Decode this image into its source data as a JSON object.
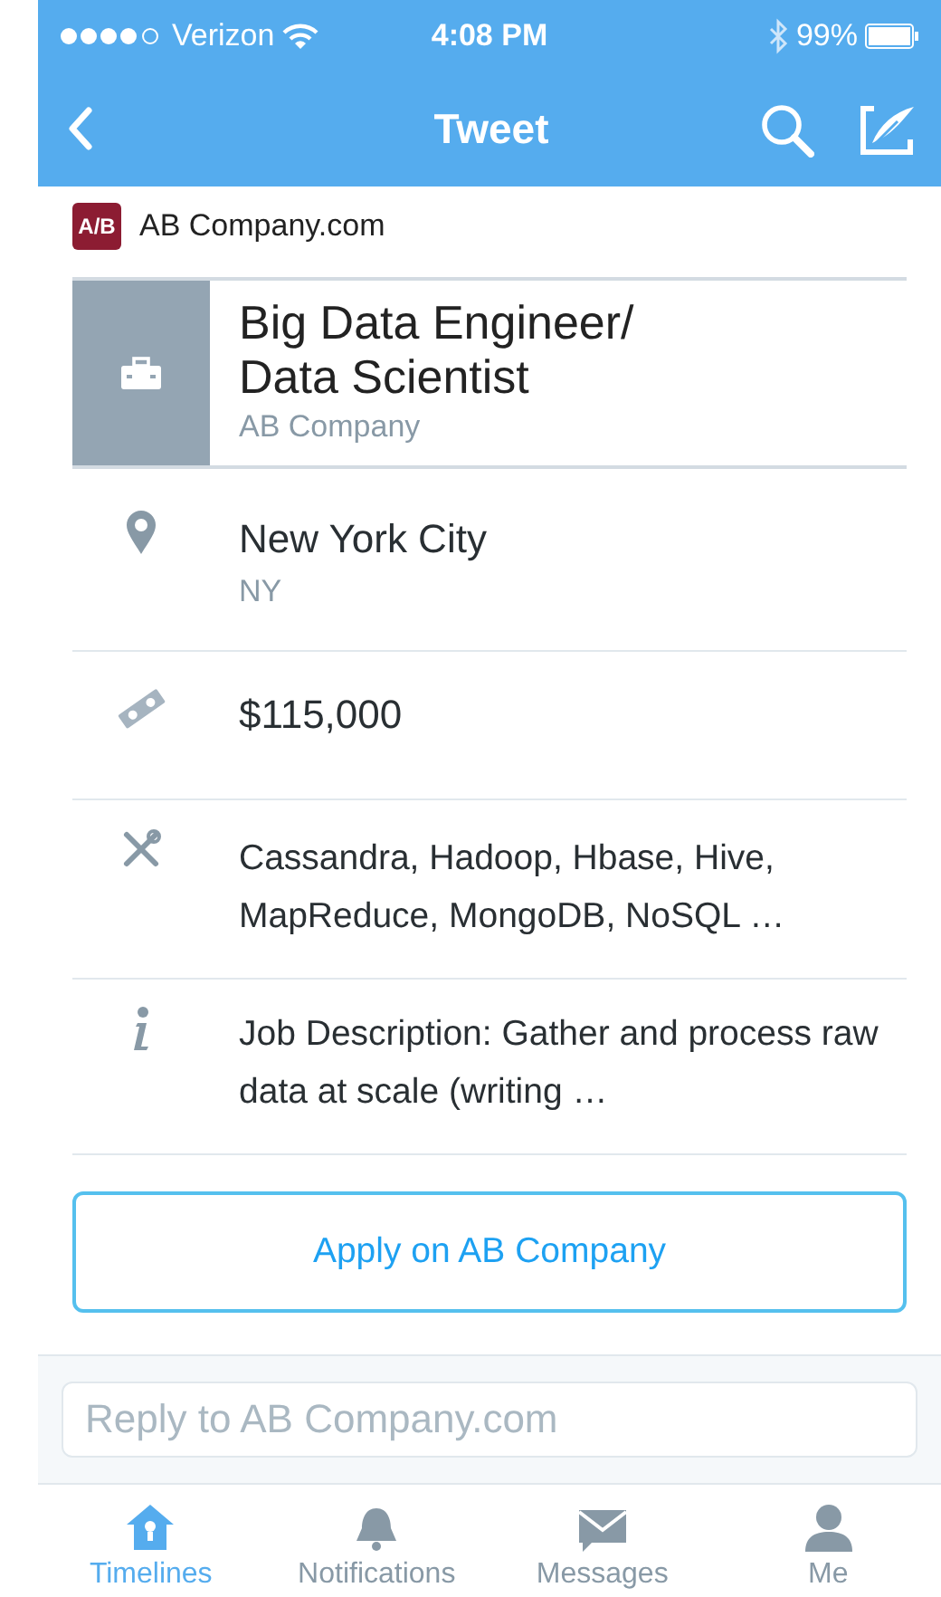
{
  "status_bar": {
    "carrier": "Verizon",
    "time": "4:08 PM",
    "battery": "99%"
  },
  "nav": {
    "title": "Tweet"
  },
  "author": {
    "logo": "A/B",
    "name": "AB Company.com"
  },
  "job": {
    "title": "Big Data Engineer/\nData Scientist",
    "company": "AB Company"
  },
  "details": [
    {
      "kind": "location",
      "primary": "New York City",
      "secondary": "NY"
    },
    {
      "kind": "salary",
      "primary": "$115,000"
    },
    {
      "kind": "skills",
      "primary": "Cassandra, Hadoop, Hbase, Hive, MapReduce, MongoDB, NoSQL …"
    },
    {
      "kind": "info",
      "primary": "Job Description: Gather and process raw data at scale (writing …"
    }
  ],
  "apply_button": "Apply on AB Company",
  "reply": {
    "placeholder": "Reply to AB Company.com"
  },
  "tabs": [
    {
      "kind": "home",
      "label": "Timelines",
      "selected": true
    },
    {
      "kind": "bell",
      "label": "Notifications",
      "selected": false
    },
    {
      "kind": "mail",
      "label": "Messages",
      "selected": false
    },
    {
      "kind": "person",
      "label": "Me",
      "selected": false
    }
  ]
}
